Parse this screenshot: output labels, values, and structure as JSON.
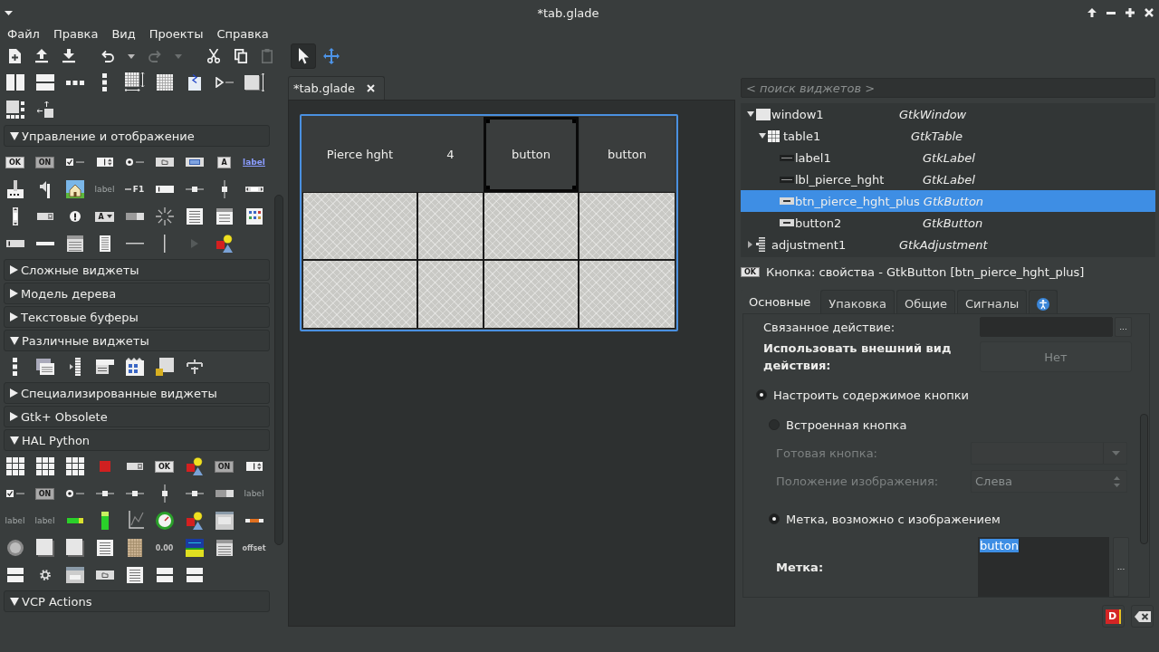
{
  "window": {
    "title": "*tab.glade"
  },
  "menu": [
    "Файл",
    "Правка",
    "Вид",
    "Проекты",
    "Справка"
  ],
  "toolbar": {
    "groups": [
      [
        {
          "kind": "new",
          "disabled": false
        },
        {
          "kind": "open",
          "disabled": false
        },
        {
          "kind": "save",
          "disabled": false
        }
      ],
      [
        {
          "kind": "undo",
          "disabled": false
        },
        {
          "kind": "undo-menu",
          "disabled": false
        },
        {
          "kind": "redo",
          "disabled": true
        },
        {
          "kind": "redo-menu",
          "disabled": true
        }
      ],
      [
        {
          "kind": "cut",
          "disabled": false
        },
        {
          "kind": "copy",
          "disabled": false
        },
        {
          "kind": "paste",
          "disabled": true
        }
      ]
    ],
    "modes": [
      {
        "kind": "select",
        "selected": true
      },
      {
        "kind": "drag",
        "selected": false
      }
    ]
  },
  "palette": {
    "top_items": [
      {
        "kind": "hpaned"
      },
      {
        "kind": "vpaned"
      },
      {
        "kind": "hbox"
      },
      {
        "kind": "vbox"
      },
      {
        "kind": "table-arrows"
      },
      {
        "kind": "grid-dots"
      },
      {
        "kind": "notebook"
      },
      {
        "kind": "expander"
      },
      {
        "kind": "frame-arrows"
      },
      {
        "kind": "layout"
      },
      {
        "kind": "fixed"
      }
    ],
    "groups": [
      {
        "title": "Управление и отображение",
        "expanded": true,
        "items": [
          {
            "kind": "btn-text",
            "text": "OK"
          },
          {
            "kind": "toggle-text",
            "text": "ON"
          },
          {
            "kind": "check"
          },
          {
            "kind": "spin"
          },
          {
            "kind": "radio"
          },
          {
            "kind": "file"
          },
          {
            "kind": "color"
          },
          {
            "kind": "btn-text",
            "text": "A"
          },
          {
            "kind": "link-text",
            "text": "label"
          },
          {
            "kind": "scale-button"
          },
          {
            "kind": "volume"
          },
          {
            "kind": "image"
          },
          {
            "kind": "dim-text",
            "text": "label"
          },
          {
            "kind": "accel-text",
            "text": "F1"
          },
          {
            "kind": "entry"
          },
          {
            "kind": "hscale"
          },
          {
            "kind": "vscale"
          },
          {
            "kind": "hscrollbar"
          },
          {
            "kind": "vscrollbar"
          },
          {
            "kind": "combo"
          },
          {
            "kind": "info"
          },
          {
            "kind": "combo-text",
            "text": "A"
          },
          {
            "kind": "progress"
          },
          {
            "kind": "spinner"
          },
          {
            "kind": "textview"
          },
          {
            "kind": "treeview"
          },
          {
            "kind": "iconview"
          },
          {
            "kind": "statusbar"
          },
          {
            "kind": "hbar"
          },
          {
            "kind": "calendar"
          },
          {
            "kind": "list"
          },
          {
            "kind": "hsep"
          },
          {
            "kind": "vsep"
          },
          {
            "kind": "arrow"
          },
          {
            "kind": "shapes"
          }
        ]
      },
      {
        "title": "Сложные виджеты",
        "expanded": false
      },
      {
        "title": "Модель дерева",
        "expanded": false
      },
      {
        "title": "Текстовые буферы",
        "expanded": false
      },
      {
        "title": "Различные виджеты",
        "expanded": true,
        "items": [
          {
            "kind": "vbox"
          },
          {
            "kind": "menu"
          },
          {
            "kind": "toolpalette"
          },
          {
            "kind": "toolbar"
          },
          {
            "kind": "iconfactory"
          },
          {
            "kind": "sizegroup"
          },
          {
            "kind": "align"
          }
        ]
      },
      {
        "title": "Специализированные виджеты",
        "expanded": false
      },
      {
        "title": "Gtk+ Obsolete",
        "expanded": false
      },
      {
        "title": "HAL Python",
        "expanded": true,
        "items": [
          {
            "kind": "grid3"
          },
          {
            "kind": "grid3"
          },
          {
            "kind": "grid3"
          },
          {
            "kind": "led"
          },
          {
            "kind": "combo"
          },
          {
            "kind": "btn-text",
            "text": "OK"
          },
          {
            "kind": "shapes"
          },
          {
            "kind": "toggle-text",
            "text": "ON"
          },
          {
            "kind": "spin"
          },
          {
            "kind": "check"
          },
          {
            "kind": "toggle-text",
            "text": "ON"
          },
          {
            "kind": "radio"
          },
          {
            "kind": "hscale"
          },
          {
            "kind": "hscale"
          },
          {
            "kind": "vscale"
          },
          {
            "kind": "hscale"
          },
          {
            "kind": "progress"
          },
          {
            "kind": "dim-text",
            "text": "label"
          },
          {
            "kind": "dim-text",
            "text": "label"
          },
          {
            "kind": "dim-text",
            "text": "label"
          },
          {
            "kind": "green-hbar"
          },
          {
            "kind": "green-vbar"
          },
          {
            "kind": "plot"
          },
          {
            "kind": "gauge"
          },
          {
            "kind": "shapes"
          },
          {
            "kind": "dialog"
          },
          {
            "kind": "orange-bar"
          },
          {
            "kind": "dial"
          },
          {
            "kind": "square"
          },
          {
            "kind": "square"
          },
          {
            "kind": "textview"
          },
          {
            "kind": "tan-grid"
          },
          {
            "kind": "plain-text",
            "text": "0.00"
          },
          {
            "kind": "screen"
          },
          {
            "kind": "calendar"
          },
          {
            "kind": "plain-text",
            "text": "offset"
          },
          {
            "kind": "stacked"
          },
          {
            "kind": "gear"
          },
          {
            "kind": "window-ok"
          },
          {
            "kind": "file"
          },
          {
            "kind": "textview"
          },
          {
            "kind": "stacked"
          },
          {
            "kind": "stacked"
          }
        ]
      },
      {
        "title": "VCP Actions",
        "expanded": true
      }
    ]
  },
  "editor": {
    "tab": {
      "title": "*tab.glade"
    },
    "design": {
      "rows": [
        [
          {
            "kind": "label",
            "text": "Pierce hght",
            "selected": false
          },
          {
            "kind": "label",
            "text": "4",
            "selected": false
          },
          {
            "kind": "button",
            "text": "button",
            "selected": true
          },
          {
            "kind": "button",
            "text": "button",
            "selected": false
          }
        ],
        [
          {
            "kind": "placeholder",
            "selected": false
          },
          {
            "kind": "placeholder",
            "selected": false
          },
          {
            "kind": "placeholder",
            "selected": false
          },
          {
            "kind": "placeholder",
            "selected": false
          }
        ],
        [
          {
            "kind": "placeholder",
            "selected": false
          },
          {
            "kind": "placeholder",
            "selected": false
          },
          {
            "kind": "placeholder",
            "selected": false
          },
          {
            "kind": "placeholder",
            "selected": false
          }
        ]
      ]
    }
  },
  "inspector": {
    "search": {
      "placeholder": "< поиск виджетов >"
    },
    "tree": [
      {
        "name": "window1",
        "type": "GtkWindow",
        "kind": "window",
        "expanded": true,
        "selected": false,
        "children": [
          {
            "name": "table1",
            "type": "GtkTable",
            "kind": "table",
            "expanded": true,
            "selected": false,
            "children": [
              {
                "name": "label1",
                "type": "GtkLabel",
                "kind": "label",
                "selected": false
              },
              {
                "name": "lbl_pierce_hght",
                "type": "GtkLabel",
                "kind": "label",
                "selected": false
              },
              {
                "name": "btn_pierce_hght_plus",
                "type": "GtkButton",
                "kind": "button",
                "selected": true
              },
              {
                "name": "button2",
                "type": "GtkButton",
                "kind": "button",
                "selected": false
              }
            ]
          }
        ]
      },
      {
        "name": "adjustment1",
        "type": "GtkAdjustment",
        "kind": "adjustment",
        "expanded": false,
        "selected": false
      }
    ]
  },
  "properties": {
    "icon_text": "OK",
    "title": "Кнопка: свойства - GtkButton [btn_pierce_hght_plus]",
    "tabs": [
      {
        "kind": "text",
        "label": "Основные",
        "selected": true
      },
      {
        "kind": "text",
        "label": "Упаковка",
        "selected": false
      },
      {
        "kind": "text",
        "label": "Общие",
        "selected": false
      },
      {
        "kind": "text",
        "label": "Сигналы",
        "selected": false
      },
      {
        "kind": "accessibility",
        "selected": false
      }
    ],
    "rows": [
      {
        "kind": "entry",
        "label": "Связанное действие:",
        "bold": false,
        "disabled": false,
        "button_label": "..."
      },
      {
        "kind": "toggle",
        "label": "Использовать внешний вид действия:",
        "bold": true,
        "on": false,
        "value": "Нет"
      },
      {
        "kind": "radio",
        "label": "Настроить содержимое кнопки",
        "selected": true,
        "children": [
          {
            "kind": "radio",
            "label": "Встроенная кнопка",
            "selected": false,
            "children": [
              {
                "kind": "combo",
                "label": "Готовая кнопка:",
                "bold": false,
                "disabled": true
              },
              {
                "kind": "spin",
                "label": "Положение изображения:",
                "bold": false,
                "disabled": true,
                "value": "Слева"
              }
            ]
          },
          {
            "kind": "radio",
            "label": "Метка, возможно с изображением",
            "selected": true,
            "children": [
              {
                "kind": "text",
                "label": "Метка:",
                "bold": true,
                "disabled": false,
                "value": "button",
                "highlighted": true,
                "button_label": "..."
              }
            ]
          }
        ]
      }
    ]
  },
  "footer_buttons": [
    {
      "kind": "docs",
      "text": "D"
    },
    {
      "kind": "clear"
    }
  ]
}
